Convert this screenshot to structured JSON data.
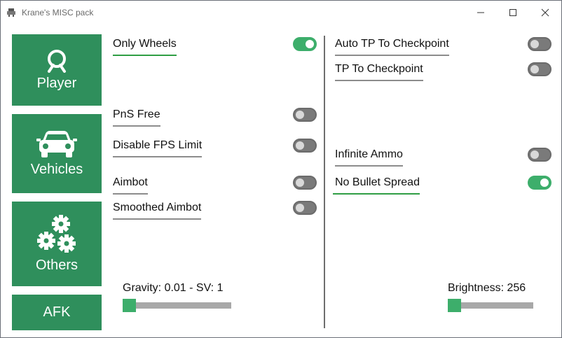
{
  "window": {
    "title": "Krane's MISC pack",
    "controls": {
      "minimize": "—",
      "maximize": "☐",
      "close": "✕"
    }
  },
  "nav": {
    "player": {
      "label": "Player",
      "icon": "user-icon"
    },
    "vehicles": {
      "label": "Vehicles",
      "icon": "car-icon"
    },
    "others": {
      "label": "Others",
      "icon": "gears-icon"
    },
    "afk": {
      "label": "AFK"
    }
  },
  "options_left": [
    {
      "label": "Only Wheels",
      "enabled": true
    },
    {
      "label": "PnS Free",
      "enabled": false
    },
    {
      "label": "Disable FPS Limit",
      "enabled": false
    },
    {
      "label": "Aimbot",
      "enabled": false
    },
    {
      "label": "Smoothed Aimbot",
      "enabled": false
    }
  ],
  "options_right": [
    {
      "label": "Auto TP To Checkpoint",
      "enabled": false
    },
    {
      "label": "TP To Checkpoint",
      "enabled": false
    },
    {
      "label": "Infinite Ammo",
      "enabled": false
    },
    {
      "label": "No Bullet Spread",
      "enabled": true
    }
  ],
  "sliders": {
    "gravity": {
      "label": "Gravity: 0.01 - SV: 1",
      "value": 0.0
    },
    "brightness": {
      "label": "Brightness: 256",
      "value": 0.0
    }
  },
  "colors": {
    "accent": "#2f8f5c",
    "toggle_on": "#3dae6b",
    "toggle_off": "#7a7a7a"
  }
}
